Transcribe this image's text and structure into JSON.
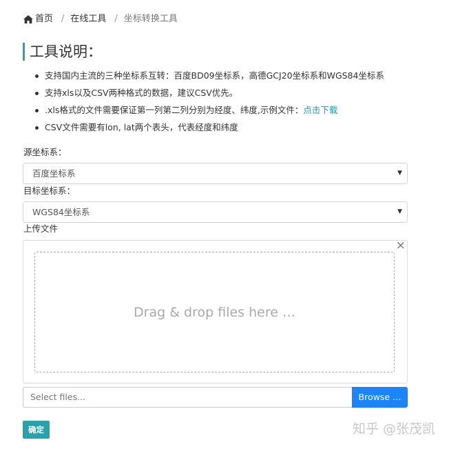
{
  "breadcrumb": {
    "home": "首页",
    "online_tools": "在线工具",
    "current": "坐标转换工具",
    "separator": "/"
  },
  "heading": "工具说明：",
  "description": {
    "items": [
      "支持国内主流的三种坐标系互转：百度BD09坐标系，高德GCJ20坐标系和WGS84坐标系",
      "支持xls以及CSV两种格式的数据，建议CSV优先。",
      ".xls格式的文件需要保证第一列第二列分别为经度、纬度,示例文件：",
      "CSV文件需要有lon, lat两个表头，代表经度和纬度"
    ],
    "download_link": "点击下载"
  },
  "form": {
    "source_label": "源坐标系：",
    "source_value": "百度坐标系",
    "target_label": "目标坐标系：",
    "target_value": "WGS84坐标系",
    "upload_label": "上传文件",
    "close_symbol": "×",
    "drop_text": "Drag & drop files here …",
    "file_placeholder": "Select files...",
    "browse_label": "Browse …",
    "confirm_label": "确定"
  },
  "watermark": "知乎 @张茂凯",
  "colors": {
    "accent": "#26a2ad",
    "browse": "#1b84ff",
    "link": "#2a9aa5"
  }
}
